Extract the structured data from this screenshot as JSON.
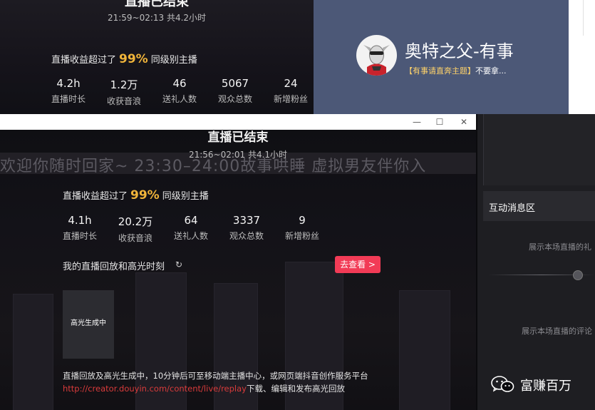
{
  "back_window": {
    "title": "直播已结束",
    "timeline": "21:59~02:13 共4.2小时",
    "earnings_prefix": "直播收益超过了",
    "earnings_percent": "99%",
    "earnings_suffix": "同级别主播",
    "stats": [
      {
        "value": "4.2h",
        "label": "直播时长"
      },
      {
        "value": "1.2万",
        "label": "收获音浪"
      },
      {
        "value": "46",
        "label": "送礼人数"
      },
      {
        "value": "5067",
        "label": "观众总数"
      },
      {
        "value": "24",
        "label": "新增粉丝"
      }
    ]
  },
  "profile": {
    "name": "奥特之父-有事",
    "subtitle_highlight": "【有事请直奔主题】",
    "subtitle_rest": "不要拿..."
  },
  "front_window": {
    "titlebar_buttons": {
      "minimize": "—",
      "maximize": "☐",
      "close": "✕"
    },
    "title": "直播已结束",
    "timeline": "21:56~02:01 共4.1小时",
    "marquee": "欢迎你随时回家~   23:30–24:00故事哄睡  虚拟男友伴你入",
    "earnings_prefix": "直播收益超过了",
    "earnings_percent": "99%",
    "earnings_suffix": "同级别主播",
    "stats": [
      {
        "value": "4.1h",
        "label": "直播时长"
      },
      {
        "value": "20.2万",
        "label": "收获音浪"
      },
      {
        "value": "64",
        "label": "送礼人数"
      },
      {
        "value": "3337",
        "label": "观众总数"
      },
      {
        "value": "9",
        "label": "新增粉丝"
      }
    ],
    "replay_label": "我的直播回放和高光时刻",
    "view_button": "去查看 >",
    "thumbnail_label": "高光生成中",
    "footnote_line1": "直播回放及高光生成中，10分钟后可至移动端主播中心，或网页端抖音创作服务平台",
    "footnote_link": "http://creator.douyin.com/content/live/replay",
    "footnote_line2_rest": "下载、编辑和发布高光回放"
  },
  "right_panel": {
    "interaction_title": "互动消息区",
    "hint_1": "展示本场直播的礼",
    "hint_2": "展示本场直播的评论"
  },
  "watermark": {
    "text": "富赚百万",
    "icon": "wechat-icon"
  },
  "colors": {
    "accent_gold": "#f0b43a",
    "button_red": "#f23b56",
    "card_blue": "#4c5877",
    "link_red": "#d93b3b"
  }
}
